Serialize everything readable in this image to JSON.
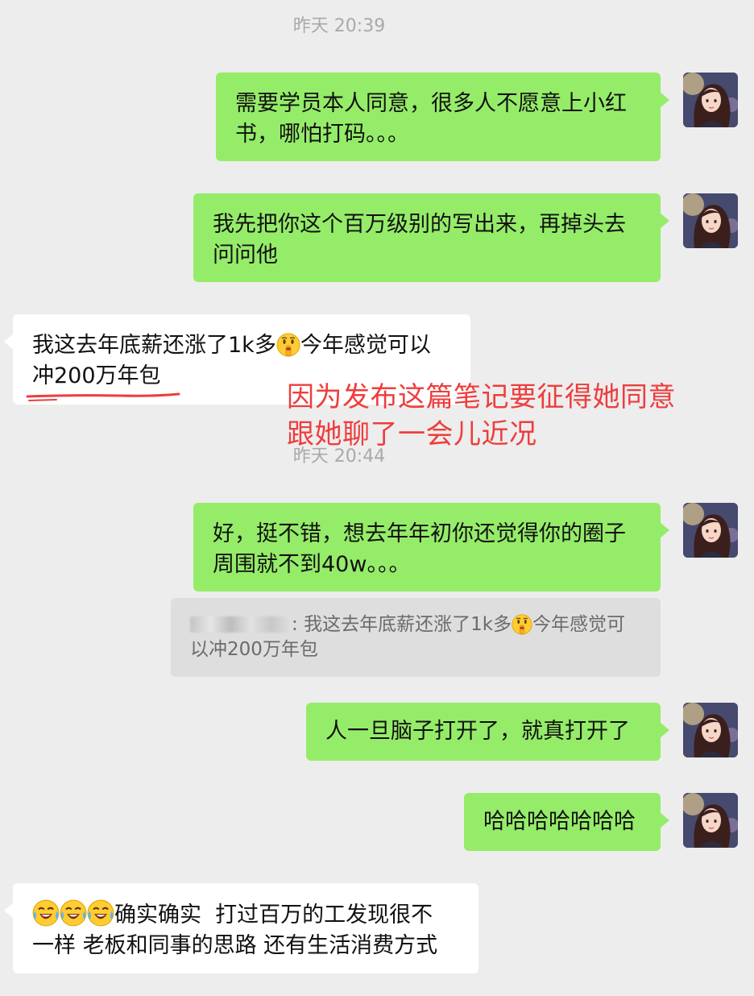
{
  "timestamps": [
    "昨天 20:39",
    "昨天 20:44"
  ],
  "messages": [
    {
      "lines": [
        "需要学员本人同意，很多人不愿意上小红",
        "书，哪怕打码。。。"
      ]
    },
    {
      "lines": [
        "我先把你这个百万级别的写出来，再掉头去",
        "问问他"
      ]
    },
    {
      "line1_before": "我这去年底薪还涨了1k多",
      "line1_after": "今年感觉可以",
      "line2": "冲200万年包"
    },
    {
      "lines": [
        "好，挺不错，想去年年初你还觉得你的圈子",
        "周围就不到40w。。。"
      ]
    },
    {
      "text": "人一旦脑子打开了，就真打开了"
    },
    {
      "text": "哈哈哈哈哈哈哈"
    },
    {
      "line1_after": "确实确实  打过百万的工发现很不",
      "line2": "一样 老板和同事的思路 还有生活消费方式"
    }
  ],
  "quote": {
    "separator": ": ",
    "line1_before": "我这去年底薪还涨了1k多",
    "line1_after": "今年感觉可",
    "line2": "以冲200万年包"
  },
  "annotation": {
    "lines": [
      "因为发布这篇笔记要征得她同意",
      "跟她聊了一会儿近况"
    ],
    "color": "#ee3d3d"
  },
  "colors": {
    "background": "#ededed",
    "my_bubble": "#95ec69",
    "other_bubble": "#ffffff",
    "timestamp": "#a9a9a9"
  },
  "icons": [
    "avatar-image",
    "shush-face-emoji",
    "tears-of-joy-emoji"
  ]
}
